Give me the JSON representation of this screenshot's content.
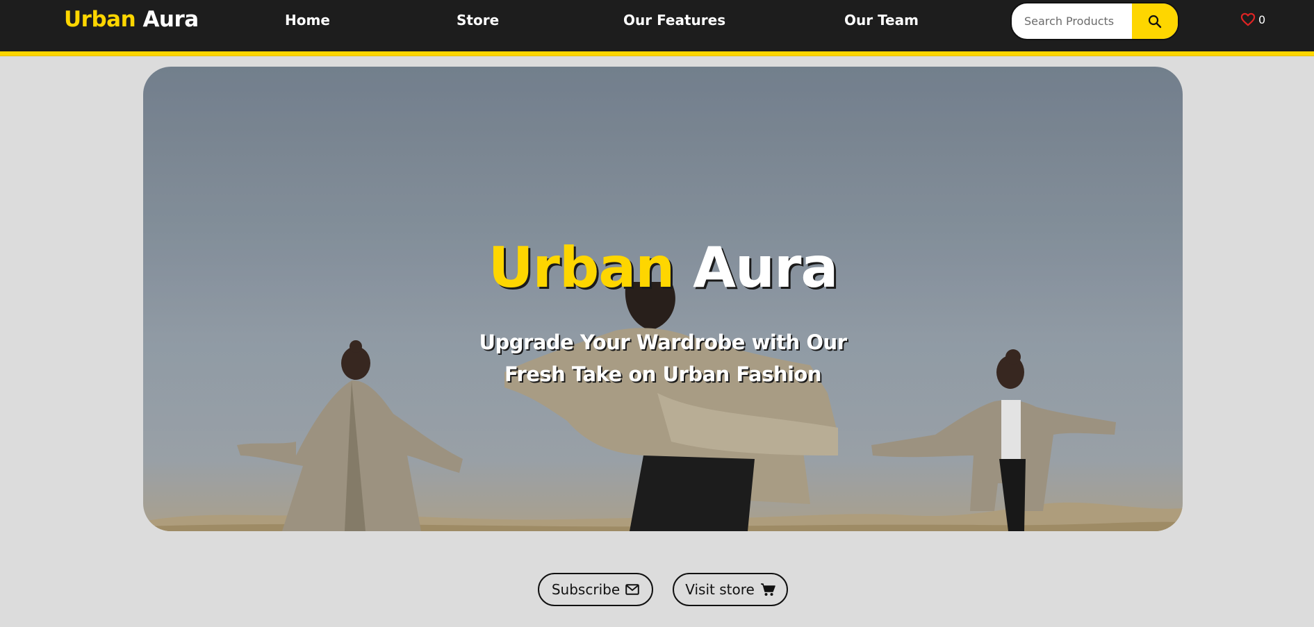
{
  "brand": {
    "first": "Urban",
    "second": "Aura"
  },
  "nav": {
    "links": [
      {
        "label": "Home"
      },
      {
        "label": "Store"
      },
      {
        "label": "Our Features"
      },
      {
        "label": "Our Team"
      }
    ]
  },
  "search": {
    "placeholder": "Search Products",
    "value": "",
    "icon": "search-icon"
  },
  "wishlist": {
    "icon": "heart-icon",
    "count": "0"
  },
  "hero": {
    "title_first": "Urban",
    "title_second": "Aura",
    "subtitle": "Upgrade Your Wardrobe with Our Fresh Take on Urban Fashion"
  },
  "cta": {
    "subscribe": {
      "label": "Subscribe",
      "icon": "envelope-icon"
    },
    "visit_store": {
      "label": "Visit store",
      "icon": "cart-icon"
    }
  },
  "colors": {
    "accent": "#fed600",
    "nav_bg": "#1d1d1d",
    "page_bg": "#dcdcdc",
    "heart": "#e02424"
  }
}
